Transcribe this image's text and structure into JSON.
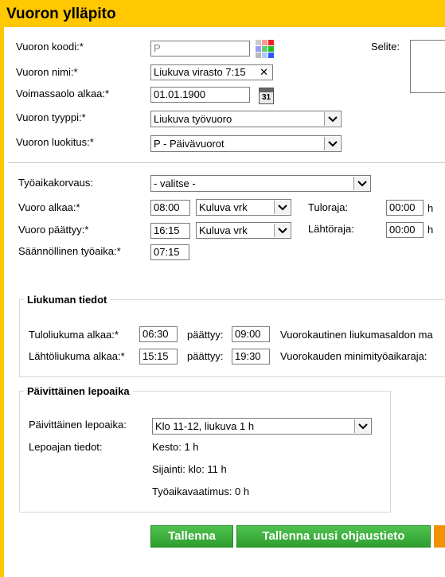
{
  "title": "Vuoron ylläpito",
  "form": {
    "koodi_label": "Vuoron koodi:*",
    "koodi_value": "P",
    "nimi_label": "Vuoron nimi:*",
    "nimi_value": "Liukuva virasto 7:15",
    "voimassa_label": "Voimassaolo alkaa:*",
    "voimassa_value": "01.01.1900",
    "tyyppi_label": "Vuoron tyyppi:*",
    "tyyppi_value": "Liukuva työvuoro",
    "luokitus_label": "Vuoron luokitus:*",
    "luokitus_value": "P - Päivävuorot",
    "selite_label": "Selite:",
    "calendar_day": "31"
  },
  "work": {
    "korvaus_label": "Työaikakorvaus:",
    "korvaus_value": "- valitse -",
    "alkaa_label": "Vuoro alkaa:*",
    "alkaa_value": "08:00",
    "alkaa_vrk": "Kuluva vrk",
    "paattyy_label": "Vuoro päättyy:*",
    "paattyy_value": "16:15",
    "paattyy_vrk": "Kuluva vrk",
    "tuloraja_label": "Tuloraja:",
    "tuloraja_value": "00:00",
    "lahtoraja_label": "Lähtöraja:",
    "lahtoraja_value": "00:00",
    "hour_unit": "h",
    "saannollinen_label": "Säännöllinen työaika:*",
    "saannollinen_value": "07:15"
  },
  "liukuma": {
    "legend": "Liukuman tiedot",
    "tulo_label": "Tuloliukuma alkaa:*",
    "tulo_value": "06:30",
    "tulo_end_label": "päättyy:",
    "tulo_end_value": "09:00",
    "saldo_label": "Vuorokautinen liukumasaldon ma",
    "lahto_label": "Lähtöliukuma alkaa:*",
    "lahto_value": "15:15",
    "lahto_end_label": "päättyy:",
    "lahto_end_value": "19:30",
    "minimi_label": "Vuorokauden minimityöaikaraja:"
  },
  "lepo": {
    "legend": "Päivittäinen lepoaika",
    "select_label": "Päivittäinen lepoaika:",
    "select_value": "Klo 11-12, liukuva 1 h",
    "tiedot_label": "Lepoajan tiedot:",
    "kesto": "Kesto: 1 h",
    "sijainti": "Sijainti: klo: 11 h",
    "vaatimus": "Työaikavaatimus: 0 h"
  },
  "buttons": {
    "save": "Tallenna",
    "save_new": "Tallenna uusi ohjaustieto"
  },
  "colors": {
    "header": "#ffc800",
    "button_green": "#3cb33c",
    "button_orange": "#f39200"
  }
}
